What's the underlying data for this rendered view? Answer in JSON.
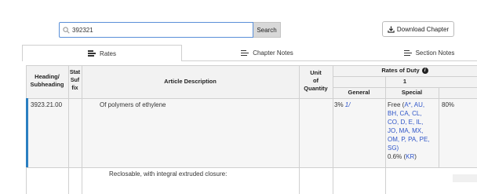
{
  "search": {
    "value": "392321",
    "button_label": "Search"
  },
  "download": {
    "label": "Download Chapter"
  },
  "tabs": [
    {
      "label": "Rates"
    },
    {
      "label": "Chapter Notes"
    },
    {
      "label": "Section Notes"
    }
  ],
  "table": {
    "headers": {
      "heading": "Heading/ Subheading",
      "stat_suffix": "Stat Suf fix",
      "description": "Article Description",
      "unit": "Unit of Quantity",
      "rates": "Rates of Duty",
      "column1": "1",
      "general": "General",
      "special": "Special"
    },
    "row": {
      "heading": "3923.21.00",
      "description": "Of polymers of ethylene",
      "general": "3% ",
      "general_footnote": "1/",
      "special_prefix": "Free (",
      "special_lines": [
        "A*, AU,",
        "BH, CA, CL,",
        "CO, D, E, IL,",
        "JO, MA, MX,",
        "OM, P, PA, PE,",
        "SG)"
      ],
      "special_alt_prefix": "0.6% (",
      "special_alt_code": "KR",
      "special_alt_suffix": ")",
      "column2": "80%"
    },
    "next_row_text": "Reclosable, with integral extruded closure:"
  }
}
